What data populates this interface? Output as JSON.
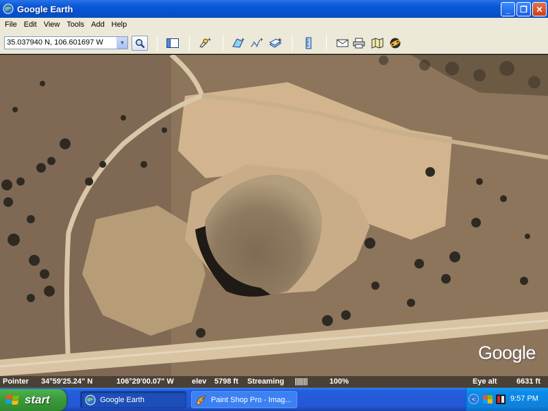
{
  "window": {
    "title": "Google Earth",
    "minimize_glyph": "_",
    "maximize_glyph": "❐",
    "close_glyph": "✕"
  },
  "menu": [
    "File",
    "Edit",
    "View",
    "Tools",
    "Add",
    "Help"
  ],
  "toolbar": {
    "coordinates_value": "35.037940 N, 106.601697 W",
    "buttons": [
      "search-icon",
      "sidebar-toggle-icon",
      "placemark-icon",
      "polygon-icon",
      "path-icon",
      "image-overlay-icon",
      "ruler-icon",
      "email-icon",
      "print-icon",
      "map-icon",
      "sky-icon"
    ]
  },
  "map": {
    "attribution": "Google"
  },
  "status": {
    "pointer_label": "Pointer",
    "latitude": "34°59'25.24\" N",
    "longitude": "106°29'00.07\" W",
    "elev_label": "elev",
    "elev_value": "5798 ft",
    "streaming_label": "Streaming",
    "streaming_bars": "||||||||||",
    "streaming_percent": "100%",
    "eye_alt_label": "Eye alt",
    "eye_alt_value": "6631 ft"
  },
  "taskbar": {
    "start_label": "start",
    "tasks": [
      {
        "label": "Google Earth",
        "active": true
      },
      {
        "label": "Paint Shop Pro - Imag...",
        "active": false
      }
    ],
    "clock": "9:57 PM"
  },
  "colors": {
    "titlebar": "#0a58d8",
    "chrome": "#ece9d8",
    "taskbar": "#245edc",
    "start": "#3c9b3c",
    "statusbar": "#4b4034"
  }
}
